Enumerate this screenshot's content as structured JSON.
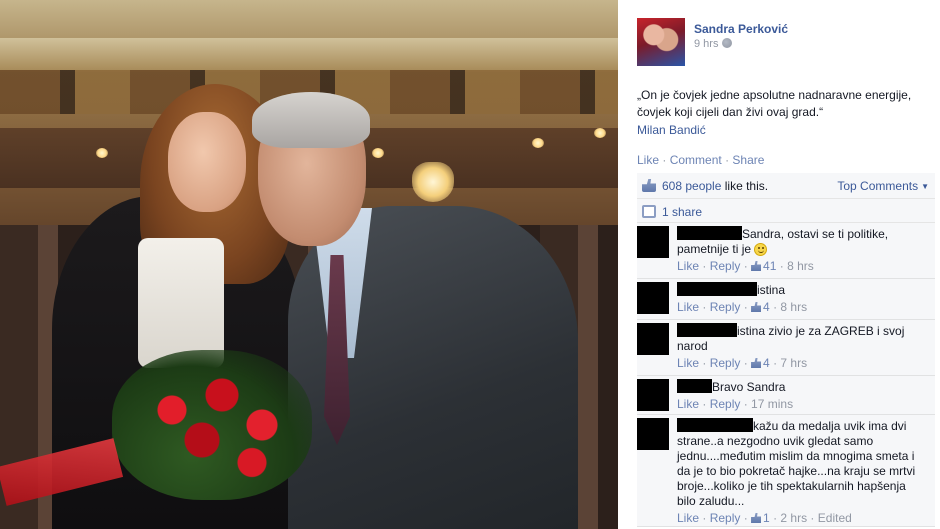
{
  "post": {
    "author": "Sandra Perković",
    "time": "9 hrs",
    "quote": "„On je čovjek jedne apsolutne nadnaravne energije, čovjek koji cijeli dan živi ovaj grad.“",
    "quote_author": "Milan Bandić",
    "actions": {
      "like": "Like",
      "comment": "Comment",
      "share": "Share",
      "sep": "·"
    },
    "likes": {
      "count": "608 people",
      "suffix": "like this."
    },
    "top_comments": "Top Comments",
    "shares": "1 share"
  },
  "comments": [
    {
      "text": "Sandra, ostavi se ti politike, pametnije ti je",
      "emoji": "smiley-icon",
      "like": "Like",
      "reply": "Reply",
      "likes": "41",
      "time": "8 hrs",
      "edited": ""
    },
    {
      "text": "istina",
      "like": "Like",
      "reply": "Reply",
      "likes": "4",
      "time": "8 hrs",
      "edited": ""
    },
    {
      "text": "istina zivio je za ZAGREB i svoj narod",
      "like": "Like",
      "reply": "Reply",
      "likes": "4",
      "time": "7 hrs",
      "edited": ""
    },
    {
      "text": "Bravo Sandra",
      "like": "Like",
      "reply": "Reply",
      "likes": "",
      "time": "17 mins",
      "edited": ""
    },
    {
      "text": "kažu da medalja uvik ima dvi strane..a nezgodno uvik gledat samo jednu....međutim mislim da mnogima smeta i da je to bio pokretač hajke...na kraju se mrtvi broje...koliko je tih spektakularnih hapšenja bilo zaludu...",
      "like": "Like",
      "reply": "Reply",
      "likes": "1",
      "time": "2 hrs",
      "edited": "Edited"
    }
  ],
  "colors": {
    "link": "#3b5998",
    "muted": "#9197a3",
    "panel": "#f6f7f9"
  }
}
